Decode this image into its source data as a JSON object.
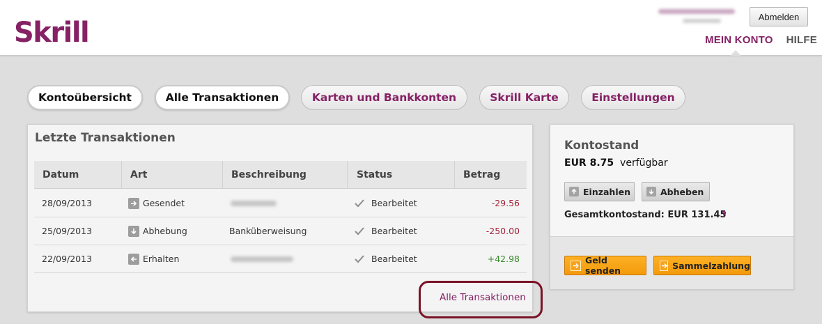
{
  "header": {
    "logo": "Skrill",
    "logout_label": "Abmelden",
    "nav": [
      {
        "label": "MEIN KONTO",
        "active": true
      },
      {
        "label": "HILFE",
        "active": false
      }
    ]
  },
  "tabs": [
    {
      "label": "Kontoübersicht"
    },
    {
      "label": "Alle Transaktionen"
    },
    {
      "label": "Karten und Bankkonten"
    },
    {
      "label": "Skrill Karte"
    },
    {
      "label": "Einstellungen"
    }
  ],
  "transactions": {
    "title": "Letzte Transaktionen",
    "columns": [
      "Datum",
      "Art",
      "Beschreibung",
      "Status",
      "Betrag"
    ],
    "rows": [
      {
        "date": "28/09/2013",
        "type": "Gesendet",
        "type_icon": "arrow-right-icon",
        "description": "",
        "status": "Bearbeitet",
        "amount": "-29.56",
        "sign": "negative"
      },
      {
        "date": "25/09/2013",
        "type": "Abhebung",
        "type_icon": "arrow-down-icon",
        "description": "Banküberweisung",
        "status": "Bearbeitet",
        "amount": "-250.00",
        "sign": "negative"
      },
      {
        "date": "22/09/2013",
        "type": "Erhalten",
        "type_icon": "arrow-left-icon",
        "description": "",
        "status": "Bearbeitet",
        "amount": "+42.98",
        "sign": "positive"
      }
    ],
    "all_link": "Alle Transaktionen"
  },
  "balance": {
    "title": "Kontostand",
    "amount": "EUR 8.75",
    "available_label": "verfügbar",
    "deposit_label": "Einzahlen",
    "withdraw_label": "Abheben",
    "total_label": "Gesamtkontostand: EUR 131.45",
    "help_mark": "?",
    "send_label": "Geld senden",
    "bulk_label": "Sammelzahlung"
  },
  "colors": {
    "brand": "#862165",
    "negative": "#a1243a",
    "positive": "#3a8a2e",
    "action": "#f7a21a",
    "annotation": "#7a1326"
  }
}
